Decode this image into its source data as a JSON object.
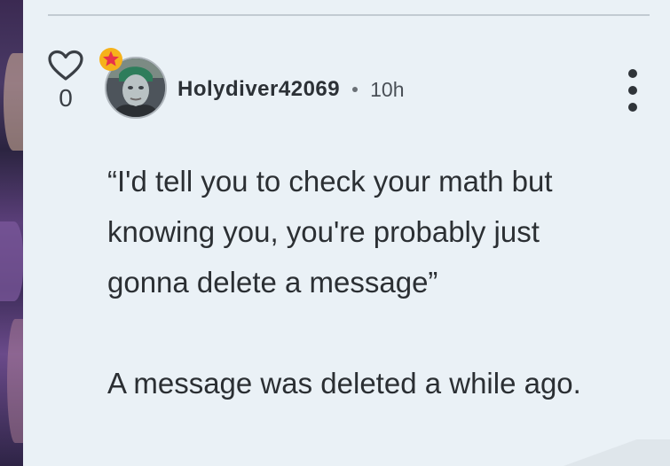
{
  "post": {
    "likes": "0",
    "username": "Holydiver42069",
    "separator": "•",
    "timestamp": "10h",
    "lines": [
      "“I'd tell you to check your math but",
      "knowing you, you're probably just",
      "gonna delete a message”"
    ],
    "note": "A message was deleted a while ago."
  },
  "icons": {
    "like": "heart-outline-icon",
    "badge": "star-badge-icon",
    "menu": "more-vertical-icon"
  },
  "colors": {
    "background": "#eaf1f6",
    "text": "#2b2f33",
    "star_fill": "#e8324a",
    "star_badge": "#f6b21b"
  }
}
